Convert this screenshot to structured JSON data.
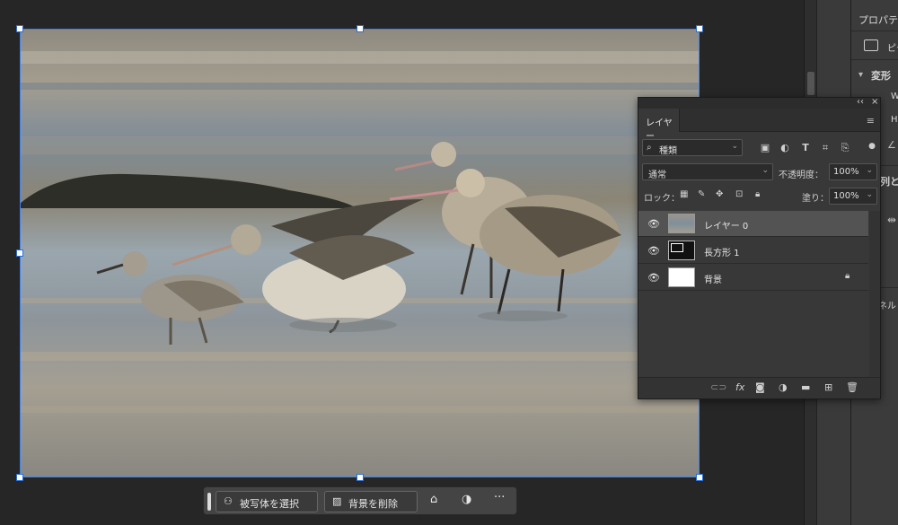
{
  "properties_panel": {
    "title": "プロパティ",
    "pixel_layer_label": "ピク",
    "transform_section": "変形",
    "w_label": "W",
    "h_label": "H",
    "align_section": "列と",
    "panel_cutoff": "ネル"
  },
  "layers_panel": {
    "collapse_glyph": "‹‹",
    "close_glyph": "×",
    "tab_label": "レイヤー",
    "filter_kind": "種類",
    "blend_mode": "通常",
    "opacity_label": "不透明度：",
    "opacity_value": "100%",
    "lock_label": "ロック：",
    "fill_label": "塗り：",
    "fill_value": "100%",
    "layers": [
      {
        "name": "レイヤー 0",
        "visible": true,
        "active": true,
        "locked": false
      },
      {
        "name": "長方形 1",
        "visible": true,
        "active": false,
        "locked": false
      },
      {
        "name": "背景",
        "visible": true,
        "active": false,
        "locked": true
      }
    ],
    "bottom_icons": [
      "link-icon",
      "fx-icon",
      "mask-icon",
      "adjustment-icon",
      "folder-icon",
      "new-layer-icon",
      "trash-icon"
    ],
    "fx_text": "fx"
  },
  "context_bar": {
    "select_subject_label": "被写体を選択",
    "remove_bg_label": "背景を削除",
    "more_glyph": "···"
  }
}
